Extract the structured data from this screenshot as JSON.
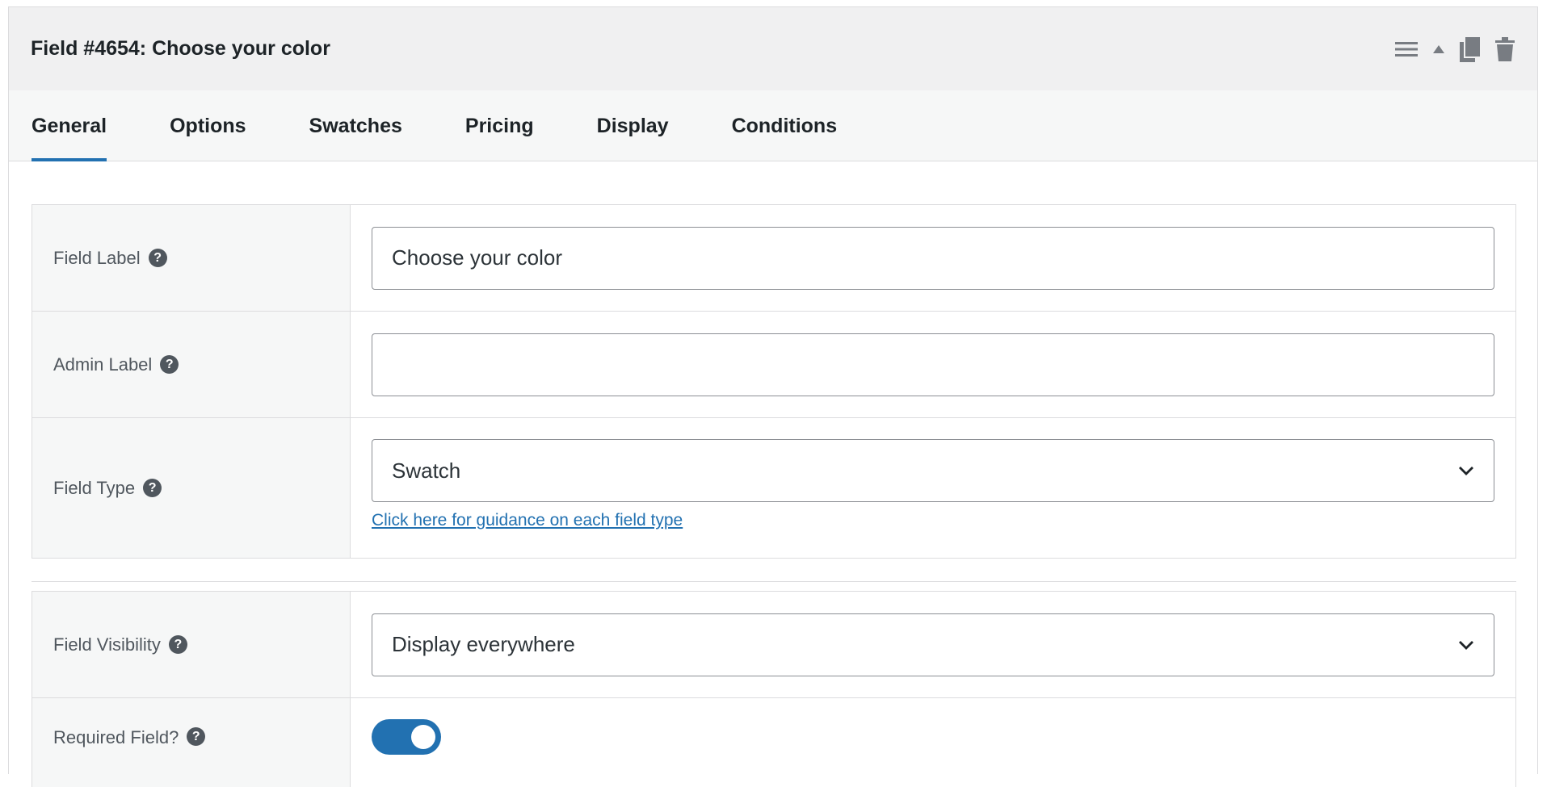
{
  "header": {
    "title": "Field #4654: Choose your color",
    "actions": [
      "menu-icon",
      "collapse-triangle-icon",
      "duplicate-icon",
      "trash-icon"
    ]
  },
  "tabs": [
    {
      "label": "General",
      "active": true
    },
    {
      "label": "Options",
      "active": false
    },
    {
      "label": "Swatches",
      "active": false
    },
    {
      "label": "Pricing",
      "active": false
    },
    {
      "label": "Display",
      "active": false
    },
    {
      "label": "Conditions",
      "active": false
    }
  ],
  "general": {
    "field_label": {
      "label": "Field Label",
      "value": "Choose your color"
    },
    "admin_label": {
      "label": "Admin Label",
      "value": ""
    },
    "field_type": {
      "label": "Field Type",
      "value": "Swatch",
      "link": "Click here for guidance on each field type"
    },
    "field_visibility": {
      "label": "Field Visibility",
      "value": "Display everywhere"
    },
    "required_field": {
      "label": "Required Field?",
      "on": true
    }
  },
  "help_glyph": "?",
  "colors": {
    "accent": "#2271b1",
    "header_bg": "#f0f0f1",
    "label_bg": "#f6f7f7",
    "border": "#dcdcde"
  }
}
